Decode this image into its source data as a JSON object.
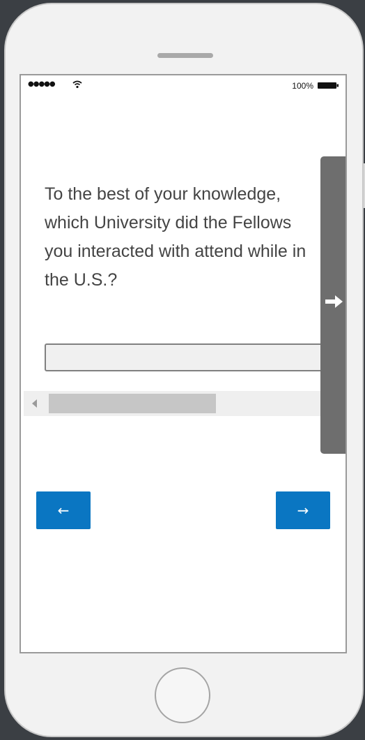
{
  "status_bar": {
    "signal": "●●●●●",
    "battery_label": "100%"
  },
  "question": {
    "text": "To the best of your knowledge, which University did the Fellows you interacted with attend while in the U.S.?"
  },
  "answer": {
    "value": "",
    "placeholder": ""
  },
  "navigation": {
    "back_label": "←",
    "next_label": "→"
  },
  "icons": {
    "wifi": "wifi-icon",
    "battery": "battery-icon",
    "side_panel_arrow": "arrow-right-icon",
    "scroll_left": "scroll-left-icon",
    "scroll_right": "scroll-right-icon"
  },
  "colors": {
    "button": "#0a76c2",
    "side_panel": "#6e6e6e",
    "question_text": "#444444"
  }
}
